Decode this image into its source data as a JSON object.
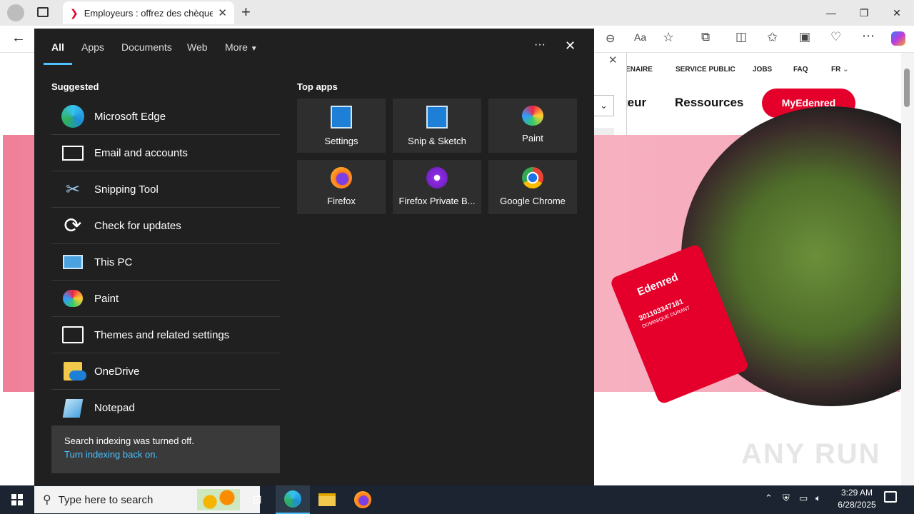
{
  "browser": {
    "tab_title": "Employeurs : offrez des chèques-r",
    "site_nav": [
      "TENAIRE",
      "SERVICE PUBLIC",
      "JOBS",
      "FAQ",
      "FR"
    ],
    "site_menu": [
      "teur",
      "Ressources"
    ],
    "cta_button": "MyEdenred",
    "card_number": "301103347181",
    "card_name": "DOMINIQUE DURANT",
    "card_brand": "Edenred",
    "watermark": "ANY RUN"
  },
  "flyout": {
    "tabs": [
      "All",
      "Apps",
      "Documents",
      "Web",
      "More"
    ],
    "suggested_title": "Suggested",
    "suggested": [
      {
        "label": "Microsoft Edge",
        "icon": "edge-icon"
      },
      {
        "label": "Email and accounts",
        "icon": "mail-icon"
      },
      {
        "label": "Snipping Tool",
        "icon": "scissors-icon"
      },
      {
        "label": "Check for updates",
        "icon": "refresh-icon"
      },
      {
        "label": "This PC",
        "icon": "computer-icon"
      },
      {
        "label": "Paint",
        "icon": "palette-icon"
      },
      {
        "label": "Themes and related settings",
        "icon": "brush-icon"
      },
      {
        "label": "OneDrive",
        "icon": "onedrive-icon"
      },
      {
        "label": "Notepad",
        "icon": "notepad-icon"
      }
    ],
    "top_apps_title": "Top apps",
    "top_apps": [
      {
        "label": "Settings",
        "icon": "settings-doc-icon"
      },
      {
        "label": "Snip & Sketch",
        "icon": "snip-doc-icon"
      },
      {
        "label": "Paint",
        "icon": "palette-icon"
      },
      {
        "label": "Firefox",
        "icon": "firefox-icon"
      },
      {
        "label": "Firefox Private B...",
        "icon": "firefox-private-icon"
      },
      {
        "label": "Google Chrome",
        "icon": "chrome-icon"
      }
    ],
    "index_notice": "Search indexing was turned off.",
    "index_link": "Turn indexing back on."
  },
  "taskbar": {
    "search_placeholder": "Type here to search",
    "time": "3:29 AM",
    "date": "6/28/2025"
  }
}
